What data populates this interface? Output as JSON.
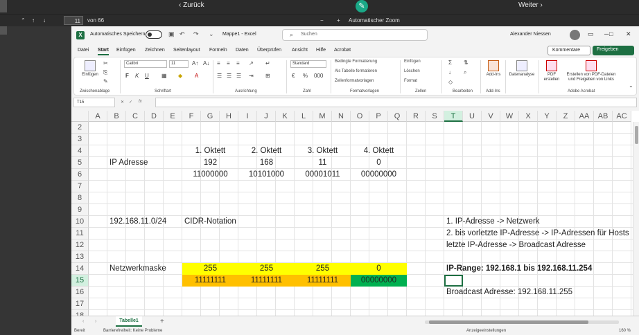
{
  "viewer": {
    "back_label": "‹ Zurück",
    "next_label": "Weiter ›",
    "page_number": "11",
    "page_of": "von 66",
    "zoom_label": "Automatischer Zoom",
    "zoom_minus": "−",
    "zoom_plus": "+"
  },
  "excel": {
    "app_icon": "X",
    "autosave_label": "Automatisches Speichern",
    "doc_name": "Mappe1 - Excel",
    "search_placeholder": "Suchen",
    "user_name": "Alexander Niessen",
    "menu": [
      "Datei",
      "Start",
      "Einfügen",
      "Zeichnen",
      "Seitenlayout",
      "Formeln",
      "Daten",
      "Überprüfen",
      "Ansicht",
      "Hilfe",
      "Acrobat"
    ],
    "active_menu": "Start",
    "comments_label": "Kommentare",
    "share_label": "Freigeben",
    "ribbon": {
      "paste_label": "Einfügen",
      "clipboard_label": "Zwischenablage",
      "font_name": "Calibri",
      "font_size": "11",
      "font_label": "Schriftart",
      "alignment_label": "Ausrichtung",
      "number_format": "Standard",
      "number_label": "Zahl",
      "cond_format": "Bedingte Formatierung",
      "format_table": "Als Tabelle formatieren",
      "cell_styles": "Zellenformatvorlagen",
      "styles_label": "Formatvorlagen",
      "insert_cells": "Einfügen",
      "delete_cells": "Löschen",
      "format_cells": "Format",
      "cells_label": "Zellen",
      "edit_label": "Bearbeiten",
      "addins_btn": "Add-Ins",
      "addins_label": "Add-Ins",
      "data_analysis": "Datenanalyse",
      "pdf_create": "PDF erstellen",
      "pdf_share": "Erstellen von PDF-Dateien und Freigeben von Links",
      "acrobat_label": "Adobe Acrobat",
      "bold": "F",
      "italic": "K",
      "underline": "U"
    },
    "name_box": "T15",
    "fx": "fx",
    "columns": [
      "A",
      "B",
      "C",
      "D",
      "E",
      "F",
      "G",
      "H",
      "I",
      "J",
      "K",
      "L",
      "M",
      "N",
      "O",
      "P",
      "Q",
      "R",
      "S",
      "T",
      "U",
      "V",
      "W",
      "X",
      "Y",
      "Z",
      "AA",
      "AB",
      "AC"
    ],
    "selected_column": "T",
    "rows": [
      "2",
      "3",
      "4",
      "5",
      "6",
      "7",
      "8",
      "9",
      "10",
      "11",
      "12",
      "13",
      "14",
      "15",
      "16",
      "17",
      "18"
    ],
    "selected_row": "15",
    "cells": {
      "h1": "1. Oktett",
      "h2": "2. Oktett",
      "h3": "3. Oktett",
      "h4": "4. Oktett",
      "ip_label": "IP Adresse",
      "ip1": "192",
      "ip2": "168",
      "ip3": "11",
      "ip4": "0",
      "bin1": "11000000",
      "bin2": "10101000",
      "bin3": "00001011",
      "bin4": "00000000",
      "cidr_value": "192.168.11.0/24",
      "cidr_label": "CIDR-Notation",
      "note1": "1. IP-Adresse -> Netzwerk",
      "note2": "2. bis vorletzte IP-Adresse -> IP-Adressen für Hosts",
      "note3": "letzte IP-Adresse -> Broadcast Adresse",
      "mask_label": "Netzwerkmaske",
      "m1": "255",
      "m2": "255",
      "m3": "255",
      "m4": "0",
      "mb1": "11111111",
      "mb2": "11111111",
      "mb3": "11111111",
      "mb4": "00000000",
      "ip_range": "IP-Range: 192.168.1 bis 192.168.11.254",
      "broadcast": "Broadcast Adresse: 192.168.11.255"
    },
    "fill_colors": {
      "yellow": "#ffff00",
      "orange": "#ffc000",
      "green": "#00b050"
    },
    "sheet_tab": "Tabelle1",
    "add_sheet": "+",
    "status_ready": "Bereit",
    "status_access": "Barrierefreiheit: Keine Probleme",
    "status_display": "Anzeigeeinstellungen",
    "status_zoom": "160 %",
    "accent": "#1d6f42"
  }
}
